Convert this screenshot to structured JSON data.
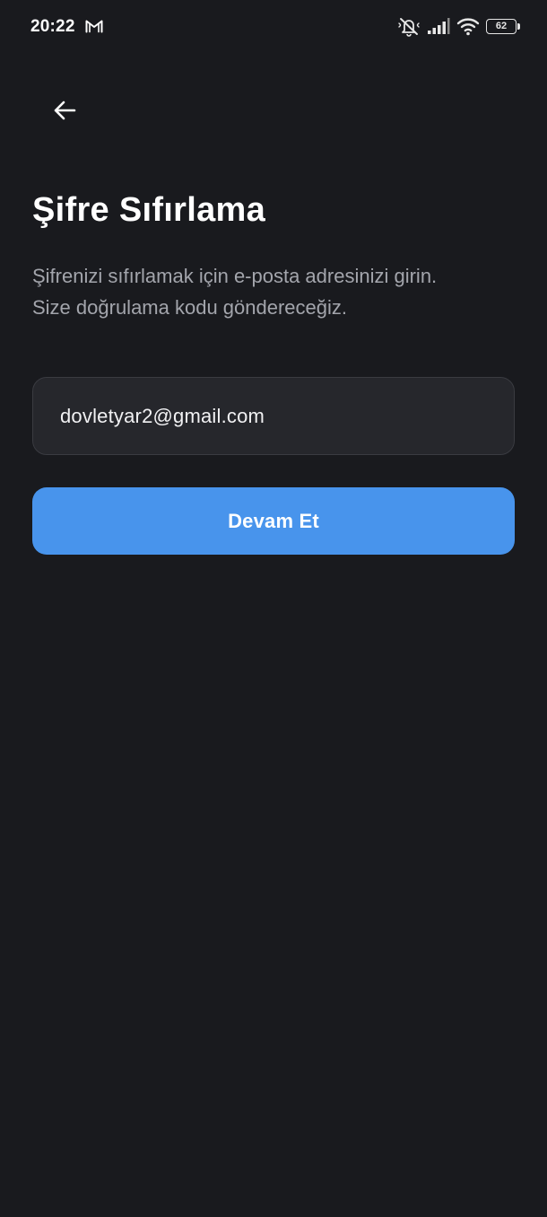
{
  "status_bar": {
    "time": "20:22",
    "notification_icon": "gmail-icon",
    "icons": [
      "mute-icon",
      "signal-icon",
      "wifi-icon"
    ],
    "battery_level": "62"
  },
  "nav": {
    "back_icon": "arrow-left-icon"
  },
  "page": {
    "title": "Şifre Sıfırlama",
    "subtitle_line1": "Şifrenizi sıfırlamak için e-posta adresinizi girin.",
    "subtitle_line2": "Size doğrulama kodu göndereceğiz."
  },
  "form": {
    "email_value": "dovletyar2@gmail.com",
    "continue_label": "Devam Et"
  },
  "colors": {
    "background": "#191a1e",
    "field_background": "#26272c",
    "field_border": "#3a3b41",
    "accent": "#4894ec",
    "subtitle_text": "#a3a5ac"
  }
}
